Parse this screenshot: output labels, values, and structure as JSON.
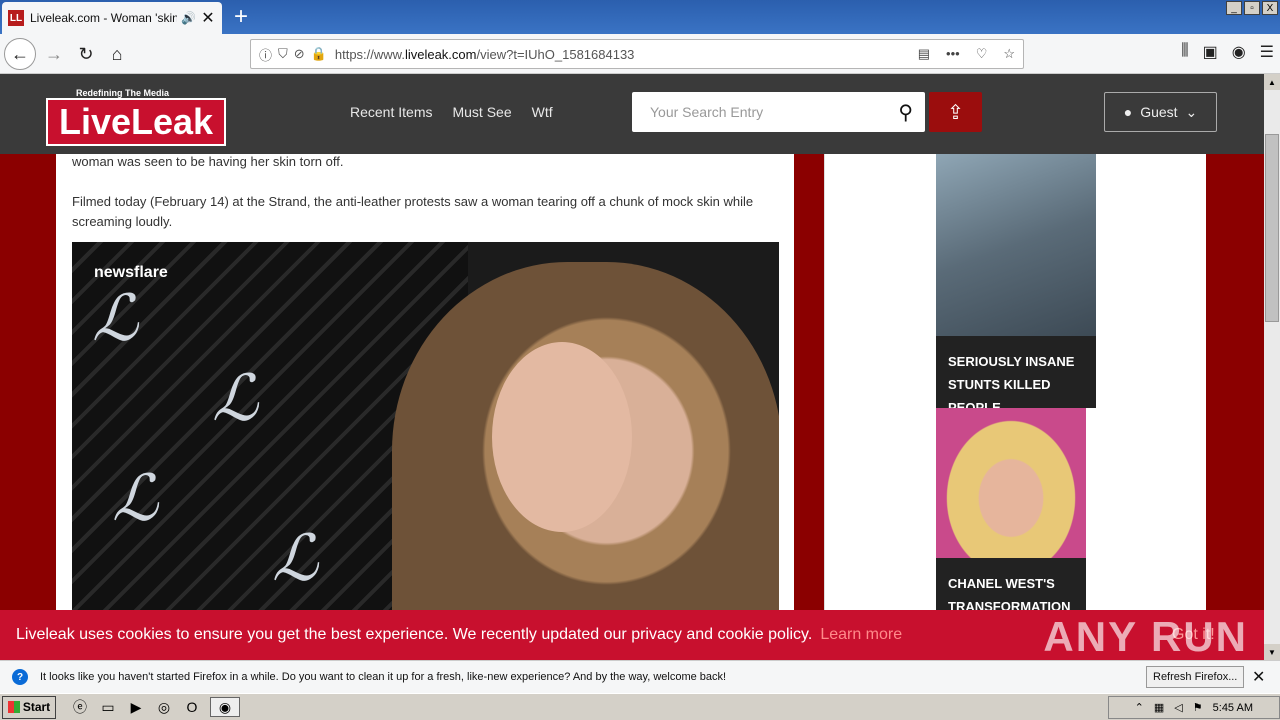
{
  "browser": {
    "tab_title": "Liveleak.com - Woman 'skinned",
    "tab_favicon_label": "LL",
    "new_tab": "+",
    "window_controls": [
      "_",
      "▫",
      "X"
    ],
    "url_prefix": "https://www.",
    "url_domain": "liveleak.com",
    "url_path": "/view?t=IUhO_1581684133",
    "toolbar_icons": [
      "library-icon",
      "sidebar-icon",
      "account-icon",
      "menu-icon"
    ]
  },
  "site": {
    "tagline": "Redefining The Media",
    "logo_text": "LiveLeak",
    "nav": [
      "Recent Items",
      "Must See",
      "Wtf"
    ],
    "search_placeholder": "Your Search Entry",
    "user_label": "Guest"
  },
  "article": {
    "para1": "woman was seen to be having her skin torn off.",
    "para2": "Filmed today (February 14) at the Strand, the anti-leather protests saw a woman tearing off a chunk of mock skin while screaming loudly.",
    "video_watermark": "newsflare"
  },
  "sidebar": {
    "caption1": "SERIOUSLY INSANE STUNTS KILLED PEOPLE",
    "caption2": "CHANEL WEST'S TRANSFORMATION IS"
  },
  "cookie": {
    "message": "Liveleak uses cookies to ensure you get the best experience. We recently updated our privacy and cookie policy.",
    "learn_more": "Learn more",
    "got_it": "Got it!"
  },
  "overlay": {
    "watermark": "ANY RUN"
  },
  "notification": {
    "message": "It looks like you haven't started Firefox in a while. Do you want to clean it up for a fresh, like-new experience? And by the way, welcome back!",
    "refresh_button": "Refresh Firefox...",
    "close": "✕"
  },
  "taskbar": {
    "start_label": "Start",
    "clock": "5:45 AM"
  },
  "colors": {
    "brand_red": "#c8102e",
    "page_bg": "#8b0000",
    "header_bg": "#3a3a3a"
  }
}
